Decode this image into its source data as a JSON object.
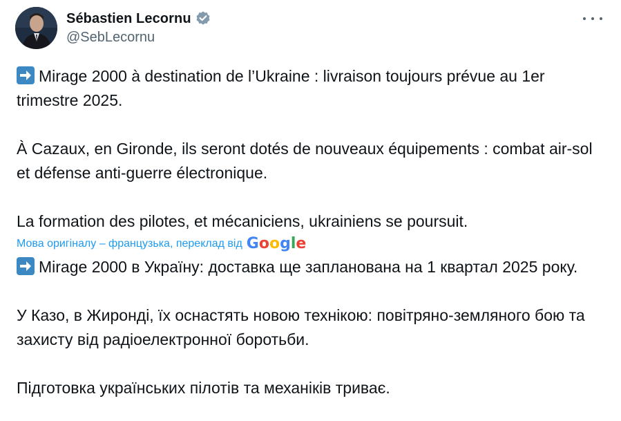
{
  "author": {
    "display_name": "Sébastien Lecornu",
    "handle": "@SebLecornu",
    "verified": true,
    "verified_color": "#829aab"
  },
  "tweet": {
    "original_paragraphs": [
      "Mirage 2000 à destination de l’Ukraine : livraison toujours prévue au 1er trimestre 2025.",
      "À Cazaux, en Gironde, ils seront dotés de nouveaux équipements : combat air-sol et défense anti-guerre électronique.",
      "La formation des pilotes, et mécaniciens, ukrainiens se poursuit."
    ],
    "translation_notice": "Мова оригіналу – французька, переклад від",
    "translation_provider": "Google",
    "translated_paragraphs": [
      "Mirage 2000 в Україну: доставка ще запланована на 1 квартал 2025 року.",
      "У Казо, в Жиронді, їх оснастять новою технікою: повітряно-земляного бою та захисту від радіоелектронної боротьби.",
      "Підготовка українських пілотів та механіків триває."
    ]
  },
  "icons": {
    "arrow": "right-arrow-emoji-icon",
    "more": "more-options-icon",
    "verified": "verified-badge-icon"
  },
  "colors": {
    "link": "#1d9bf0",
    "secondary_text": "#536471",
    "primary_text": "#0f1419"
  }
}
